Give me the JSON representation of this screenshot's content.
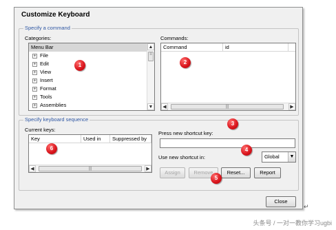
{
  "dialog": {
    "title": "Customize Keyboard",
    "command_group_label": "Specify a command",
    "categories_label": "Categories:",
    "categories": [
      "Menu Bar",
      "File",
      "Edit",
      "View",
      "Insert",
      "Format",
      "Tools",
      "Assemblies"
    ],
    "commands_label": "Commands:",
    "commands_columns": [
      "Command",
      "id"
    ],
    "sequence_group_label": "Specify keyboard sequence",
    "current_keys_label": "Current keys:",
    "current_keys_columns": [
      "Key",
      "Used in",
      "Suppressed by"
    ],
    "press_shortcut_label": "Press new shortcut key:",
    "press_shortcut_value": "",
    "use_shortcut_label": "Use new shortcut in:",
    "use_shortcut_value": "Global",
    "buttons": {
      "assign": "Assign",
      "remove": "Remove",
      "reset": "Reset...",
      "report": "Report",
      "close": "Close"
    }
  },
  "icons": {
    "expand": "plus-box-icon",
    "scroll_up": "arrow-up-icon",
    "scroll_down": "arrow-down-icon",
    "scroll_left": "arrow-left-icon",
    "scroll_right": "arrow-right-icon"
  },
  "callouts": [
    "1",
    "2",
    "3",
    "4",
    "5",
    "6"
  ],
  "watermark": "头条号 / 一对一教你学习ugbi"
}
